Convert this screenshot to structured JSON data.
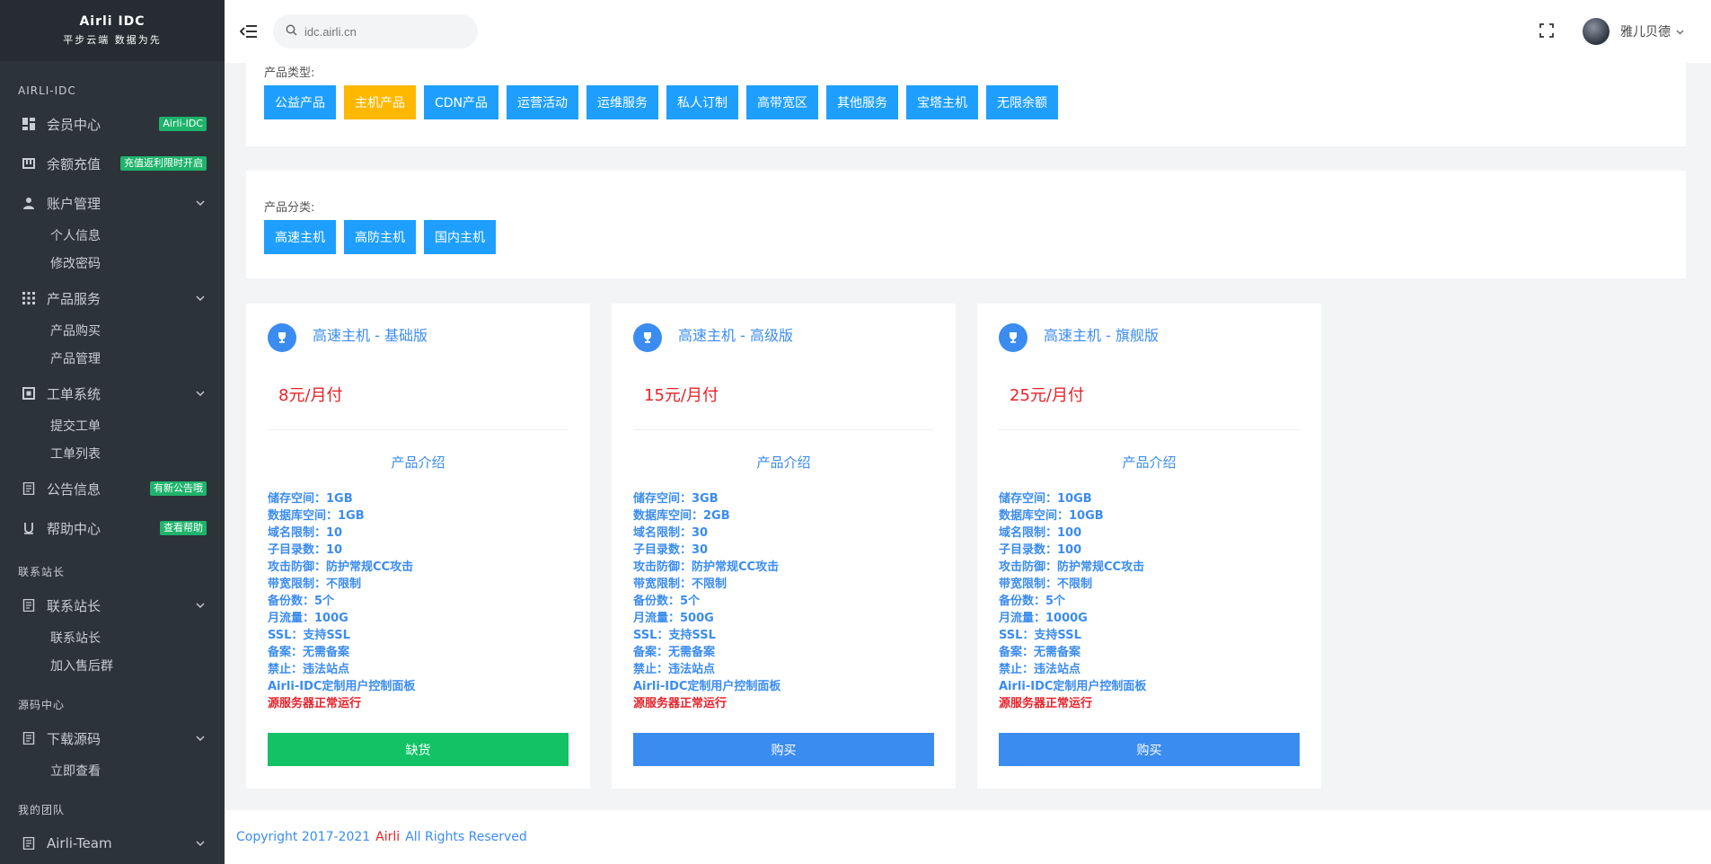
{
  "sidebar": {
    "brand_line1": "Airli IDC",
    "brand_line2": "平步云端 数据为先",
    "sections": [
      {
        "title": "AIRLI-IDC"
      },
      {
        "title": "联系站长"
      },
      {
        "title": "源码中心"
      },
      {
        "title": "我的团队"
      }
    ],
    "items": [
      {
        "label": "会员中心",
        "badge": "Airli-IDC",
        "icon": "dashboard-icon"
      },
      {
        "label": "余额充值",
        "badge": "充值返利限时开启",
        "icon": "wallet-icon"
      },
      {
        "label": "账户管理",
        "icon": "user-icon",
        "subs": [
          "个人信息",
          "修改密码"
        ]
      },
      {
        "label": "产品服务",
        "icon": "grid-icon",
        "subs": [
          "产品购买",
          "产品管理"
        ]
      },
      {
        "label": "工单系统",
        "icon": "ticket-icon",
        "subs": [
          "提交工单",
          "工单列表"
        ]
      },
      {
        "label": "公告信息",
        "badge": "有新公告哦",
        "icon": "notice-icon"
      },
      {
        "label": "帮助中心",
        "badge": "查看帮助",
        "icon": "help-icon"
      },
      {
        "label": "联系站长",
        "icon": "document-icon",
        "subs": [
          "联系站长",
          "加入售后群"
        ]
      },
      {
        "label": "下载源码",
        "icon": "document-icon",
        "subs": [
          "立即查看"
        ]
      },
      {
        "label": "Airli-Team",
        "icon": "document-icon"
      }
    ]
  },
  "topbar": {
    "search_placeholder": "idc.airli.cn",
    "username": "雅儿贝德"
  },
  "product_types": {
    "label": "产品类型:",
    "buttons": [
      "公益产品",
      "主机产品",
      "CDN产品",
      "运营活动",
      "运维服务",
      "私人订制",
      "高带宽区",
      "其他服务",
      "宝塔主机",
      "无限余额"
    ],
    "active_index": 1
  },
  "product_categories": {
    "label": "产品分类:",
    "buttons": [
      "高速主机",
      "高防主机",
      "国内主机"
    ]
  },
  "cards": [
    {
      "title": "高速主机 - 基础版",
      "price": "8元/月付",
      "intro": "产品介绍",
      "specs": [
        "储存空间：1GB",
        "数据库空间：1GB",
        "域名限制：10",
        "子目录数：10",
        "攻击防御：防护常规CC攻击",
        "带宽限制：不限制",
        "备份数：5个",
        "月流量：100G",
        "SSL：支持SSL",
        "备案：无需备案",
        "禁止：违法站点",
        "Airli-IDC定制用户控制面板"
      ],
      "status": "源服务器正常运行",
      "button": "缺货",
      "button_color": "#12c265"
    },
    {
      "title": "高速主机 - 高级版",
      "price": "15元/月付",
      "intro": "产品介绍",
      "specs": [
        "储存空间：3GB",
        "数据库空间：2GB",
        "域名限制：30",
        "子目录数：30",
        "攻击防御：防护常规CC攻击",
        "带宽限制：不限制",
        "备份数：5个",
        "月流量：500G",
        "SSL：支持SSL",
        "备案：无需备案",
        "禁止：违法站点",
        "Airli-IDC定制用户控制面板"
      ],
      "status": "源服务器正常运行",
      "button": "购买",
      "button_color": "#3b8cf0"
    },
    {
      "title": "高速主机 - 旗舰版",
      "price": "25元/月付",
      "intro": "产品介绍",
      "specs": [
        "储存空间：10GB",
        "数据库空间：10GB",
        "域名限制：100",
        "子目录数：100",
        "攻击防御：防护常规CC攻击",
        "带宽限制：不限制",
        "备份数：5个",
        "月流量：1000G",
        "SSL：支持SSL",
        "备案：无需备案",
        "禁止：违法站点",
        "Airli-IDC定制用户控制面板"
      ],
      "status": "源服务器正常运行",
      "button": "购买",
      "button_color": "#3b8cf0"
    }
  ],
  "footer": {
    "prefix": "Copyright 2017-2021",
    "brand": "Airli",
    "suffix": "All Rights Reserved"
  }
}
